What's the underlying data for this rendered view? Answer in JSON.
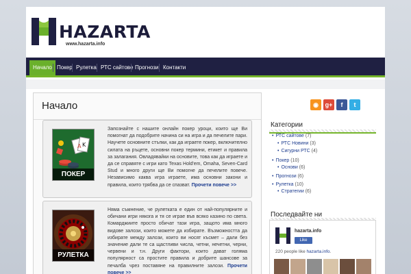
{
  "site": {
    "logo_text": "HAZARTA",
    "logo_url": "www.hazarta.info"
  },
  "nav": {
    "items": [
      {
        "label": "Начало",
        "active": true
      },
      {
        "label": "Покер",
        "active": false
      },
      {
        "label": "Рулетка",
        "active": false
      },
      {
        "label": "РТС сайтове",
        "active": false
      },
      {
        "label": "Прогнози",
        "active": false
      },
      {
        "label": "Контакти",
        "active": false
      }
    ]
  },
  "main": {
    "title": "Начало",
    "posts": [
      {
        "image_label": "ПОКЕР",
        "text": "Запознайте с нашите онлайн покер уроци, които ще Ви помогнат да подобрите начина си на игра и да печелите пари. Научете основните стъпки, как да играете покер, включително силата на ръцете, основни покер термини, етикет и правила за залагания. Овладявайки на основите, това как да играете и да се справяте с игри като Texas Hold'em, Omaha, Seven-Card Stud и много други ще Ви помогне да печелите повече. Независимо каква игра играете, има основни закони и правила, които трябва да се спазват.",
        "read_more": "Прочети повече >>"
      },
      {
        "image_label": "РУЛЕТКА",
        "text": "Няма съмнение, че рулетката е един от най-популярните и обичани игри някога и тя се играе във всяко казино по света. Комарджиите просто обичат тази игра, защото има много видове залози, които можете да избирате. Възможността да избирате между залози, които ви носят късмет – дали без значение дали те са щастливи числа, четни, нечетни, черни, червени и т.н. Други фактори, които дават голяма популярност са простите правила и добрите шансове за печалба чрез поставяне на правилните залози.",
        "read_more": "Прочети повече >>"
      }
    ]
  },
  "sidebar": {
    "social": [
      {
        "name": "rss-icon",
        "glyph": "◉",
        "color": "#f7931e"
      },
      {
        "name": "google-plus-icon",
        "glyph": "g+",
        "color": "#dd4b39"
      },
      {
        "name": "facebook-icon",
        "glyph": "f",
        "color": "#3b5998"
      },
      {
        "name": "twitter-icon",
        "glyph": "t",
        "color": "#33aee5"
      }
    ],
    "categories_title": "Категории",
    "categories": [
      {
        "label": "РТС сайтове",
        "count": "(7)"
      },
      {
        "label": "РТС Новини",
        "count": "(3)"
      },
      {
        "label": "Сигурни РТС",
        "count": "(4)"
      },
      {
        "label": "Покер",
        "count": "(10)"
      },
      {
        "label": "Основи",
        "count": "(6)"
      },
      {
        "label": "Прогнози",
        "count": "(6)"
      },
      {
        "label": "Рулетка",
        "count": "(10)"
      },
      {
        "label": "Стратегии",
        "count": "(6)"
      }
    ],
    "latest_title": "Последвайте ни",
    "fb": {
      "name": "hazarta.info",
      "like": "Like",
      "count_text": "220 people like",
      "count_link": "hazarta.info",
      "count_end": "."
    }
  },
  "colors": {
    "nav_bg": "#1f2042",
    "accent_green": "#6ab02b",
    "link_blue": "#1e3d8f"
  }
}
